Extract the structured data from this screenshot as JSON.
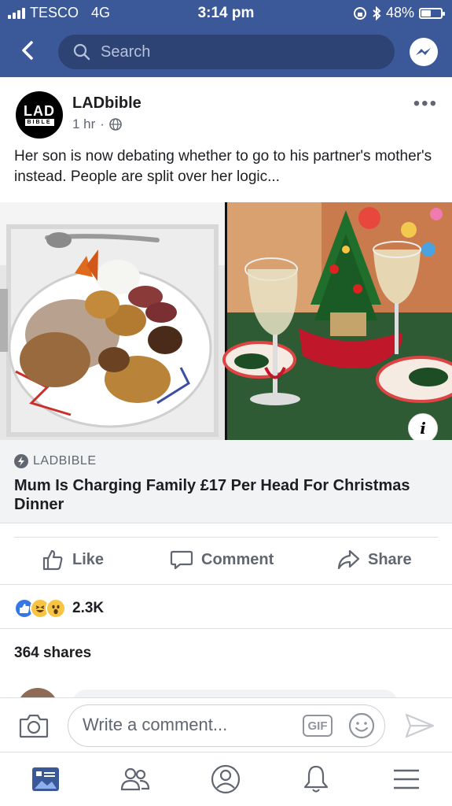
{
  "status": {
    "carrier": "TESCO",
    "network": "4G",
    "time": "3:14 pm",
    "battery": "48%",
    "battery_level": 0.48
  },
  "search": {
    "placeholder": "Search"
  },
  "post": {
    "page_name": "LADbible",
    "avatar_line1": "LAD",
    "avatar_line2": "BIBLE",
    "time": "1 hr",
    "separator": "·",
    "text": "Her son is now debating whether to go to his partner's mother's instead. People are split over her logic..."
  },
  "link": {
    "source": "LADBIBLE",
    "title": "Mum Is Charging Family £17 Per Head For Christmas Dinner",
    "info_label": "i"
  },
  "actions": {
    "like": "Like",
    "comment": "Comment",
    "share": "Share"
  },
  "engagement": {
    "reactions_count": "2.3K",
    "shares": "364 shares"
  },
  "comment_bar": {
    "placeholder": "Write a comment...",
    "gif_label": "GIF"
  },
  "icons": [
    "back-icon",
    "search-icon",
    "messenger-icon",
    "globe-icon",
    "more-icon",
    "like-icon",
    "comment-icon",
    "share-icon",
    "camera-icon",
    "emoji-icon",
    "send-icon",
    "news-feed-icon",
    "friends-icon",
    "profile-icon",
    "notifications-icon",
    "menu-icon"
  ],
  "colors": {
    "brand": "#3b5998",
    "text_secondary": "#606770",
    "preview_bg": "#f2f3f5",
    "like_blue": "#3578e5"
  }
}
